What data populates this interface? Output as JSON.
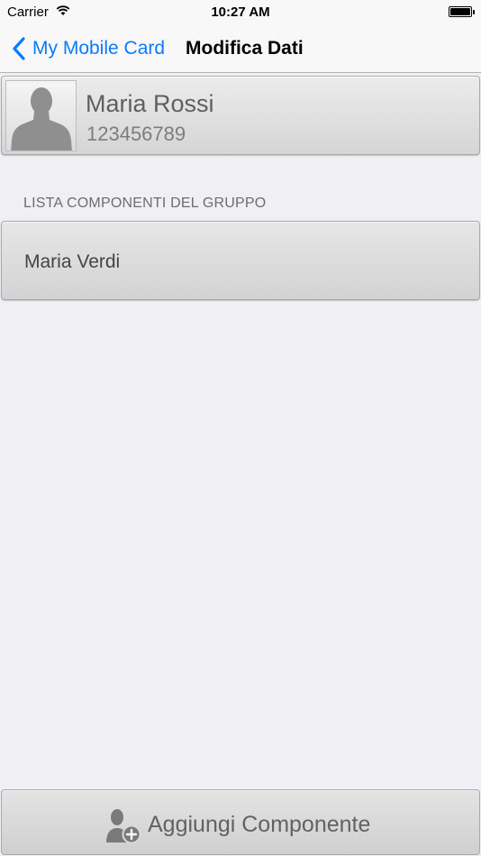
{
  "status_bar": {
    "carrier": "Carrier",
    "time": "10:27 AM",
    "wifi_icon": "wifi-icon",
    "battery_icon": "battery-icon"
  },
  "nav": {
    "back_label": "My Mobile Card",
    "title": "Modifica Dati",
    "back_icon": "chevron-left-icon",
    "accent_color": "#0b7bff"
  },
  "profile": {
    "name": "Maria Rossi",
    "card_number": "123456789",
    "avatar_icon": "person-silhouette-icon"
  },
  "group": {
    "header": "LISTA COMPONENTI DEL GRUPPO",
    "members": [
      {
        "name": "Maria Verdi"
      }
    ]
  },
  "actions": {
    "add_member_label": "Aggiungi Componente",
    "add_member_icon": "add-person-icon"
  }
}
